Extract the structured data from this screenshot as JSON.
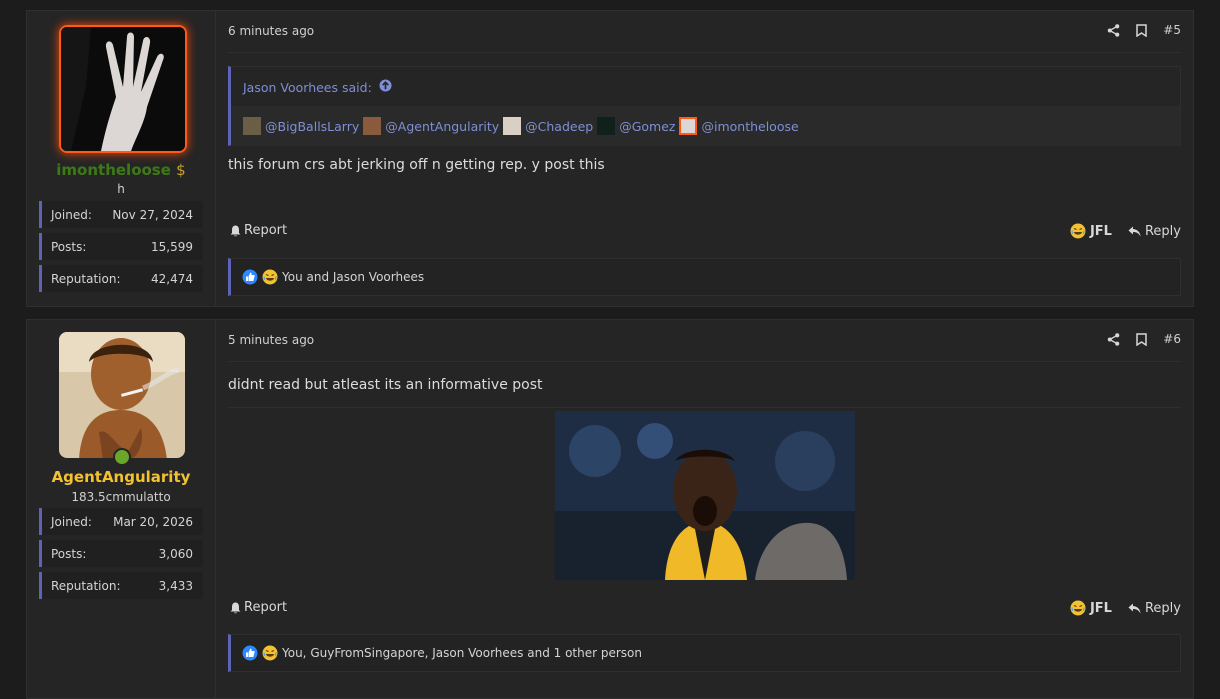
{
  "posts": [
    {
      "user": {
        "name": "imontheloose",
        "badge": "$",
        "title": "h",
        "stats": [
          {
            "label": "Joined:",
            "value": "Nov 27, 2024"
          },
          {
            "label": "Posts:",
            "value": "15,599"
          },
          {
            "label": "Reputation:",
            "value": "42,474"
          }
        ]
      },
      "time": "6 minutes ago",
      "number": "#5",
      "quote": {
        "author": "Jason Voorhees said:",
        "mentions": [
          "@BigBallsLarry",
          "@AgentAngularity",
          "@Chadeep",
          "@Gomez",
          "@imontheloose"
        ]
      },
      "message": "this forum crs abt jerking off n getting rep. y post this",
      "actions": {
        "report": "Report",
        "jfl": "JFL",
        "reply": "Reply"
      },
      "reactions": "You and Jason Voorhees"
    },
    {
      "user": {
        "name": "AgentAngularity",
        "title": "183.5cmmulatto",
        "stats": [
          {
            "label": "Joined:",
            "value": "Mar 20, 2026"
          },
          {
            "label": "Posts:",
            "value": "3,060"
          },
          {
            "label": "Reputation:",
            "value": "3,433"
          }
        ]
      },
      "time": "5 minutes ago",
      "number": "#6",
      "message": "didnt read but atleast its an informative post",
      "actions": {
        "report": "Report",
        "jfl": "JFL",
        "reply": "Reply"
      },
      "reactions": "You, GuyFromSingapore, Jason Voorhees and 1 other person"
    }
  ],
  "colors": {
    "accent": "#5d63b5",
    "link": "#7e8fd6",
    "username_green": "#3d7a16",
    "username_gold": "#f2c230",
    "avatar_glow": "#ff5a1a"
  },
  "icons": [
    "share-icon",
    "bookmark-icon",
    "bell-icon",
    "reply-icon",
    "arrow-up-circle-icon",
    "like-icon",
    "laugh-emoji-icon"
  ]
}
